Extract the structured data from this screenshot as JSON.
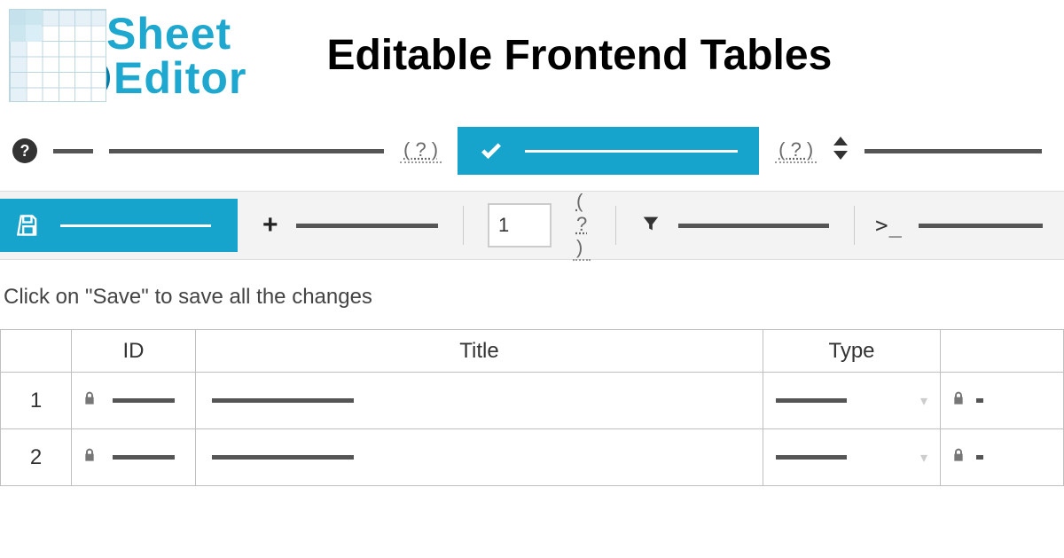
{
  "logo": {
    "top": "Sheet",
    "bottom": "Editor"
  },
  "page_title": "Editable Frontend Tables",
  "toolbar1": {
    "help_link1": "( ? )",
    "help_link2": "( ? )"
  },
  "toolbar2": {
    "page_value": "1",
    "help_link": "( ? )",
    "terminal_glyph": ">_"
  },
  "hint": "Click on \"Save\" to save all the changes",
  "table": {
    "columns": [
      "ID",
      "Title",
      "Type"
    ],
    "rows": [
      {
        "num": "1"
      },
      {
        "num": "2"
      }
    ]
  }
}
